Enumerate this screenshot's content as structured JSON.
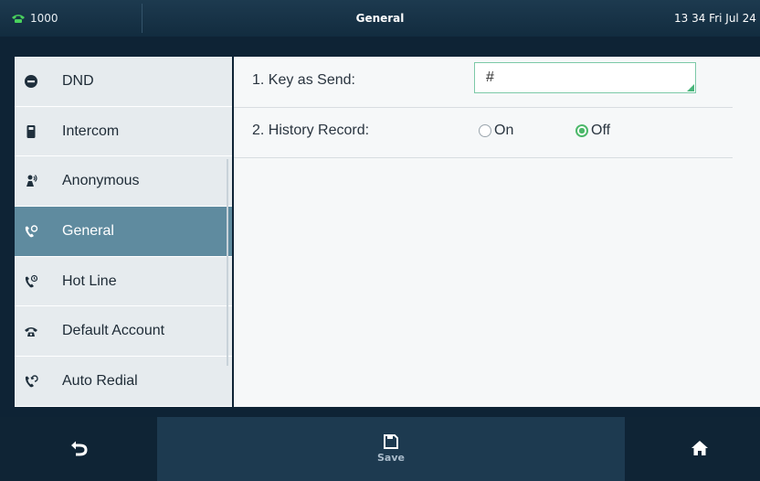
{
  "status_bar": {
    "account": "1000",
    "title": "General",
    "datetime": "13 34 Fri Jul 24"
  },
  "sidebar": {
    "items": [
      {
        "label": "DND",
        "icon": "dnd-icon",
        "active": false
      },
      {
        "label": "Intercom",
        "icon": "intercom-icon",
        "active": false
      },
      {
        "label": "Anonymous",
        "icon": "anonymous-icon",
        "active": false
      },
      {
        "label": "General",
        "icon": "general-call-icon",
        "active": true
      },
      {
        "label": "Hot Line",
        "icon": "hotline-icon",
        "active": false
      },
      {
        "label": "Default Account",
        "icon": "phone-icon",
        "active": false
      },
      {
        "label": "Auto Redial",
        "icon": "auto-redial-icon",
        "active": false
      }
    ]
  },
  "settings": {
    "key_as_send": {
      "label": "1. Key as Send:",
      "value": "#"
    },
    "history_record": {
      "label": "2. History Record:",
      "options": [
        "On",
        "Off"
      ],
      "selected": "Off"
    }
  },
  "bottom_bar": {
    "save_label": "Save",
    "back_icon": "back-icon",
    "save_icon": "save-icon",
    "home_icon": "home-icon"
  },
  "colors": {
    "accent_green": "#4cb86a",
    "active_item": "#5f8b9f",
    "status_bar": "#1d3a4f",
    "bottom_bar": "#0f2435"
  }
}
